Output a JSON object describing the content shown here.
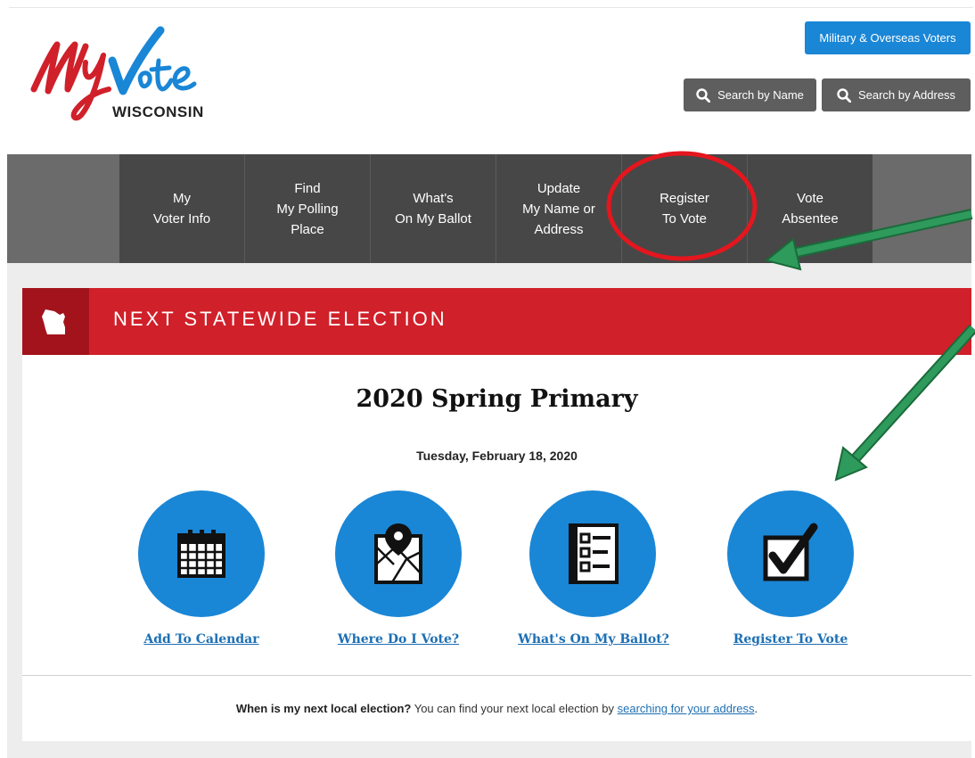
{
  "logo": {
    "script_text": "MyVote",
    "state": "WISCONSIN",
    "colors": {
      "my": "#d0202a",
      "vote": "#1a86d6"
    }
  },
  "header": {
    "military_button": "Military & Overseas Voters",
    "search_name_button": "Search by Name",
    "search_address_button": "Search by Address"
  },
  "nav": {
    "items": [
      {
        "label": "My\nVoter Info"
      },
      {
        "label": "Find\nMy Polling\nPlace"
      },
      {
        "label": "What's\nOn My Ballot"
      },
      {
        "label": "Update\nMy Name or\nAddress"
      },
      {
        "label": "Register\nTo Vote"
      },
      {
        "label": "Vote\nAbsentee"
      }
    ]
  },
  "banner": {
    "title": "NEXT STATEWIDE ELECTION",
    "color": "#d0202a"
  },
  "election": {
    "name": "2020 Spring Primary",
    "date": "Tuesday, February 18, 2020"
  },
  "actions": [
    {
      "label": "Add To Calendar",
      "icon": "calendar-icon"
    },
    {
      "label": "Where Do I Vote?",
      "icon": "map-pin-icon"
    },
    {
      "label": "What's On My Ballot?",
      "icon": "ballot-list-icon"
    },
    {
      "label": "Register To Vote",
      "icon": "checkbox-icon"
    }
  ],
  "footer": {
    "question": "When is my next local election?",
    "text": " You can find your next local election by ",
    "link": "searching for your address",
    "end": "."
  }
}
